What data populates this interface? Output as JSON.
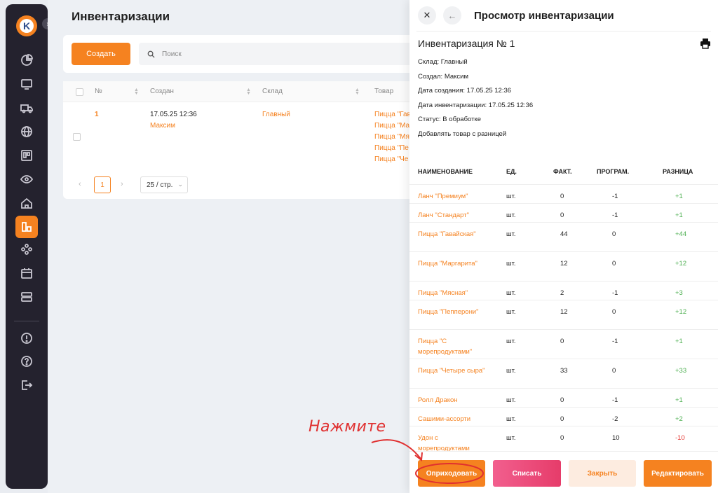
{
  "app": {
    "logo_letter": "K"
  },
  "sidebar": {
    "icons": [
      "chart-pie-icon",
      "monitor-icon",
      "truck-icon",
      "globe-icon",
      "board-icon",
      "eye-icon",
      "home-icon",
      "warehouse-icon",
      "network-icon",
      "calendar-icon",
      "server-icon",
      "alert-icon",
      "help-icon",
      "logout-icon"
    ],
    "active": "warehouse-icon",
    "accent": "#f58220"
  },
  "list": {
    "title": "Инвентаризации",
    "create_label": "Создать",
    "search_placeholder": "Поиск",
    "columns": [
      "№",
      "Создан",
      "Склад",
      "Товар"
    ],
    "row": {
      "number": "1",
      "created_date": "17.05.25 12:36",
      "created_by": "Максим",
      "warehouse": "Главный",
      "products": [
        "Пицца \"Гав",
        "Пицца \"Ма",
        "Пицца \"Мя",
        "Пицца \"Пе",
        "Пицца \"Че"
      ]
    },
    "pager": {
      "prev": "‹",
      "current": "1",
      "next": "›",
      "per_page": "25 / стр."
    }
  },
  "drawer": {
    "title": "Просмотр инвентаризации",
    "inventory_title": "Инвентаризация № 1",
    "meta": [
      "Склад: Главный",
      "Создал: Максим",
      "Дата создания: 17.05.25 12:36",
      "Дата инвентаризации: 17.05.25 12:36",
      "Статус: В обработке",
      "Добавлять товар с разницей"
    ],
    "headers": {
      "name": "НАИМЕНОВАНИЕ",
      "unit": "ЕД.",
      "fact": "ФАКТ.",
      "prog": "ПРОГРАМ.",
      "diff": "РАЗНИЦА"
    },
    "items": [
      {
        "name": "Ланч \"Премиум\"",
        "unit": "шт.",
        "fact": "0",
        "prog": "-1",
        "diff": "+1"
      },
      {
        "name": "Ланч \"Стандарт\"",
        "unit": "шт.",
        "fact": "0",
        "prog": "-1",
        "diff": "+1"
      },
      {
        "name": "Пицца \"Гавайская\"",
        "unit": "шт.",
        "fact": "44",
        "prog": "0",
        "diff": "+44"
      },
      {
        "name": "Пицца \"Маргарита\"",
        "unit": "шт.",
        "fact": "12",
        "prog": "0",
        "diff": "+12"
      },
      {
        "name": "Пицца \"Мясная\"",
        "unit": "шт.",
        "fact": "2",
        "prog": "-1",
        "diff": "+3"
      },
      {
        "name": "Пицца \"Пепперони\"",
        "unit": "шт.",
        "fact": "12",
        "prog": "0",
        "diff": "+12"
      },
      {
        "name": "Пицца \"С морепродуктами\"",
        "unit": "шт.",
        "fact": "0",
        "prog": "-1",
        "diff": "+1"
      },
      {
        "name": "Пицца \"Четыре сыра\"",
        "unit": "шт.",
        "fact": "33",
        "prog": "0",
        "diff": "+33"
      },
      {
        "name": "Ролл Дракон",
        "unit": "шт.",
        "fact": "0",
        "prog": "-1",
        "diff": "+1"
      },
      {
        "name": "Сашими-ассорти",
        "unit": "шт.",
        "fact": "0",
        "prog": "-2",
        "diff": "+2"
      },
      {
        "name": "Удон с морепродуктами",
        "unit": "шт.",
        "fact": "0",
        "prog": "10",
        "diff": "-10"
      }
    ],
    "buttons": {
      "receive": "Оприходовать",
      "write_off": "Списать",
      "close": "Закрыть",
      "edit": "Редактировать"
    }
  },
  "annotation": {
    "hint": "Нажмите",
    "color": "#e03030"
  }
}
